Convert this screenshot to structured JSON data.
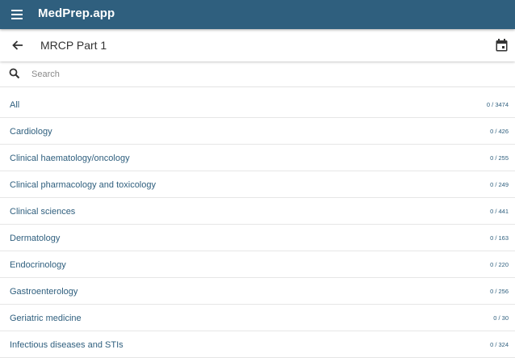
{
  "app": {
    "title": "MedPrep.app",
    "bar_color": "#2f5f7e",
    "menu_icon": "hamburger-menu-icon"
  },
  "header": {
    "title": "MRCP Part 1",
    "back_icon": "arrow-left-icon",
    "calendar_icon": "calendar-icon"
  },
  "search": {
    "placeholder": "Search",
    "value": "",
    "icon": "search-icon"
  },
  "categories": [
    {
      "label": "All",
      "count": "0 / 3474"
    },
    {
      "label": "Cardiology",
      "count": "0 / 426"
    },
    {
      "label": "Clinical haematology/oncology",
      "count": "0 / 255"
    },
    {
      "label": "Clinical pharmacology and toxicology",
      "count": "0 / 249"
    },
    {
      "label": "Clinical sciences",
      "count": "0 / 441"
    },
    {
      "label": "Dermatology",
      "count": "0 / 163"
    },
    {
      "label": "Endocrinology",
      "count": "0 / 220"
    },
    {
      "label": "Gastroenterology",
      "count": "0 / 256"
    },
    {
      "label": "Geriatric medicine",
      "count": "0 / 30"
    },
    {
      "label": "Infectious diseases and STIs",
      "count": "0 / 324"
    }
  ]
}
